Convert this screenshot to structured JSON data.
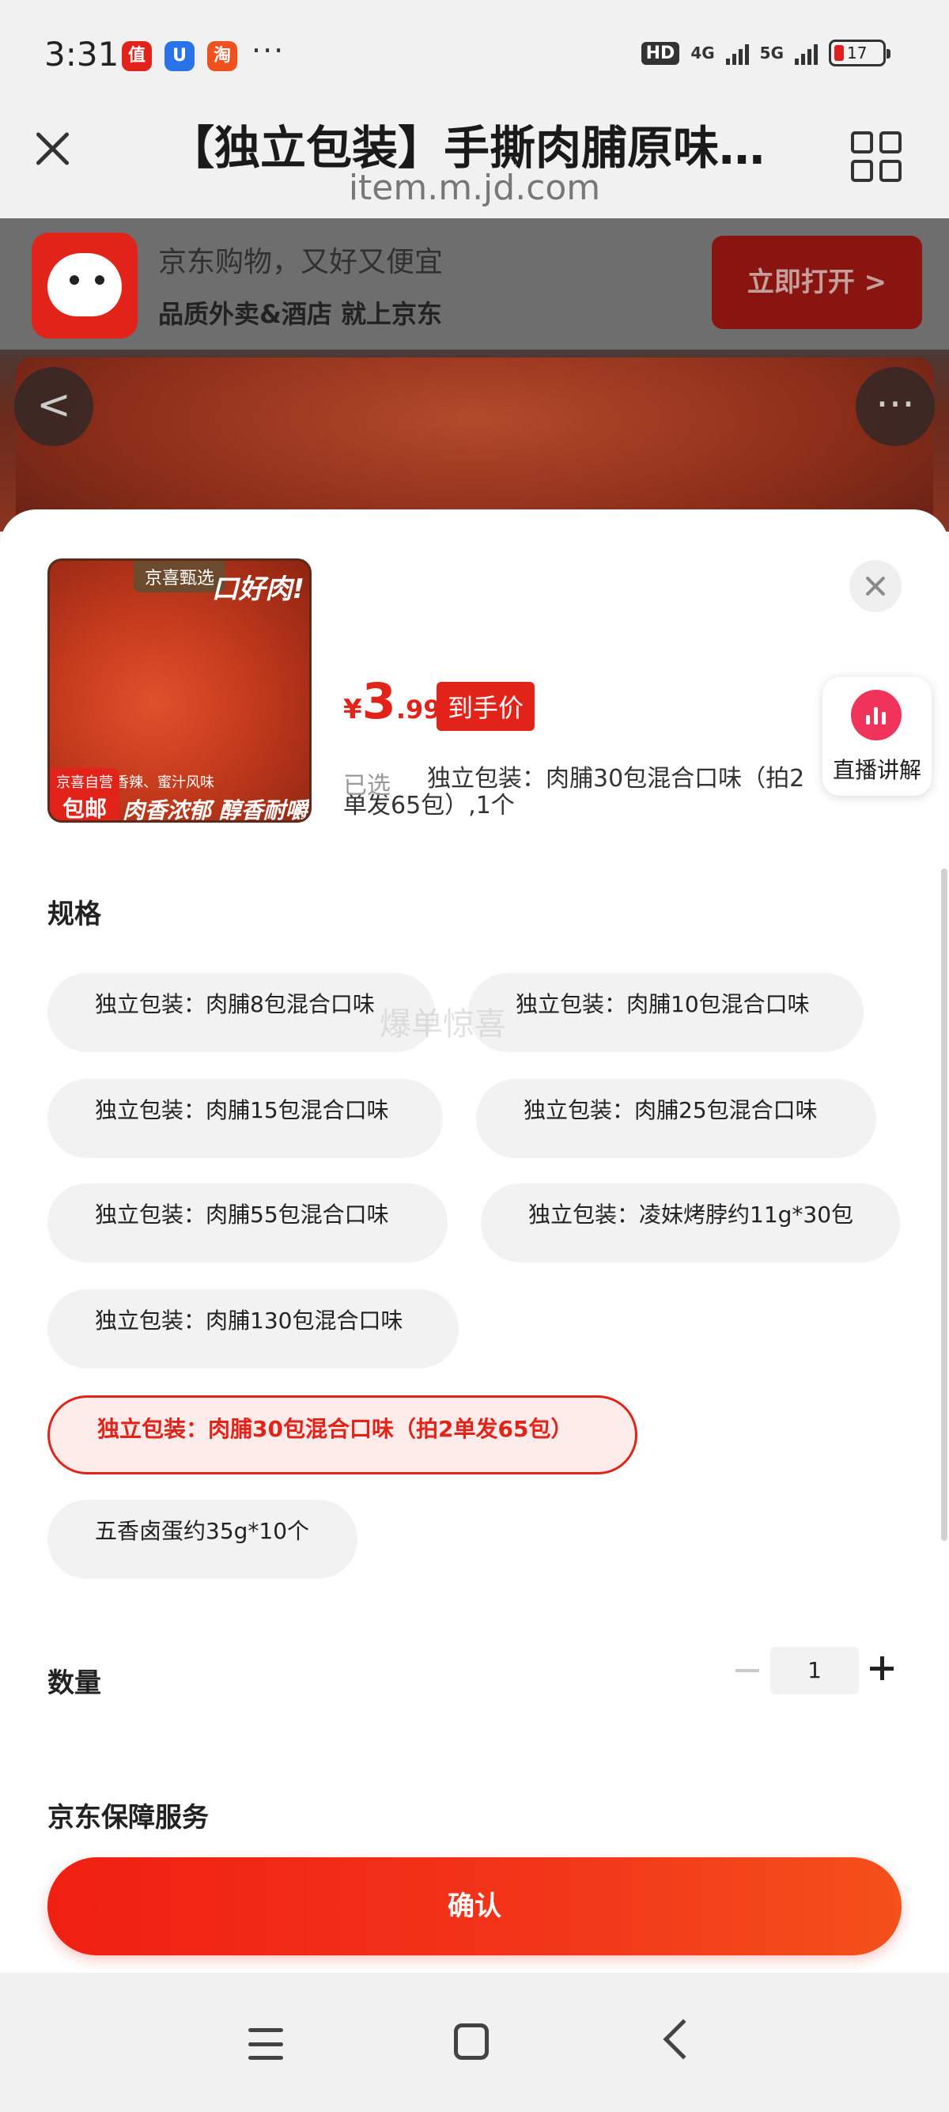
{
  "status_bar": {
    "time": "3:31",
    "apps": [
      {
        "name": "zhi-app-icon",
        "glyph": "值",
        "color": "#e2231a"
      },
      {
        "name": "shield-app-icon",
        "glyph": "U",
        "color": "#2a72e8"
      },
      {
        "name": "taobao-app-icon",
        "glyph": "淘",
        "color": "#f0501e"
      }
    ],
    "more": "···",
    "hd_badge": "HD",
    "net1": "4G",
    "net2": "5G",
    "battery": "17"
  },
  "browser": {
    "title": "【独立包装】手撕肉脯原味…",
    "url": "item.m.jd.com"
  },
  "banner": {
    "line1": "京东购物，又好又便宜",
    "line2": "品质外卖&酒店 就上京东",
    "open_button": "立即打开 >"
  },
  "hero": {
    "prev": "<",
    "more": "···"
  },
  "product": {
    "thumb": {
      "tag_top": "京喜甄选",
      "slogan_top": "口好肉!",
      "flavors": "香辣、蜜汁风味",
      "slogan_bottom": "肉香浓郁 醇香耐嚼",
      "badge_line1": "京喜自营",
      "badge_line2": "包邮"
    },
    "price_symbol": "¥",
    "price_int": "3",
    "price_dec": ".99",
    "price_tag": "到手价",
    "selected_label": "已选",
    "selected_value": "独立包装：肉脯30包混合口味（拍2单发65包）,1个",
    "live_label": "直播讲解"
  },
  "spec": {
    "title": "规格",
    "options": [
      {
        "label": "独立包装：肉脯8包混合口味",
        "active": false
      },
      {
        "label": "独立包装：肉脯10包混合口味",
        "active": false
      },
      {
        "label": "独立包装：肉脯15包混合口味",
        "active": false
      },
      {
        "label": "独立包装：肉脯25包混合口味",
        "active": false
      },
      {
        "label": "独立包装：肉脯55包混合口味",
        "active": false
      },
      {
        "label": "独立包装：凌妹烤脖约11g*30包",
        "active": false
      },
      {
        "label": "独立包装：肉脯130包混合口味",
        "active": false
      },
      {
        "label": "独立包装：肉脯30包混合口味（拍2单发65包）",
        "active": true
      },
      {
        "label": "五香卤蛋约35g*10个",
        "active": false
      }
    ],
    "watermark": "爆单惊喜"
  },
  "quantity": {
    "title": "数量",
    "value": "1"
  },
  "service": {
    "title": "京东保障服务"
  },
  "confirm_label": "确认",
  "colors": {
    "accent": "#e2231a",
    "chip_bg": "#f2f2f2",
    "active_chip_bg": "#fdecea"
  }
}
